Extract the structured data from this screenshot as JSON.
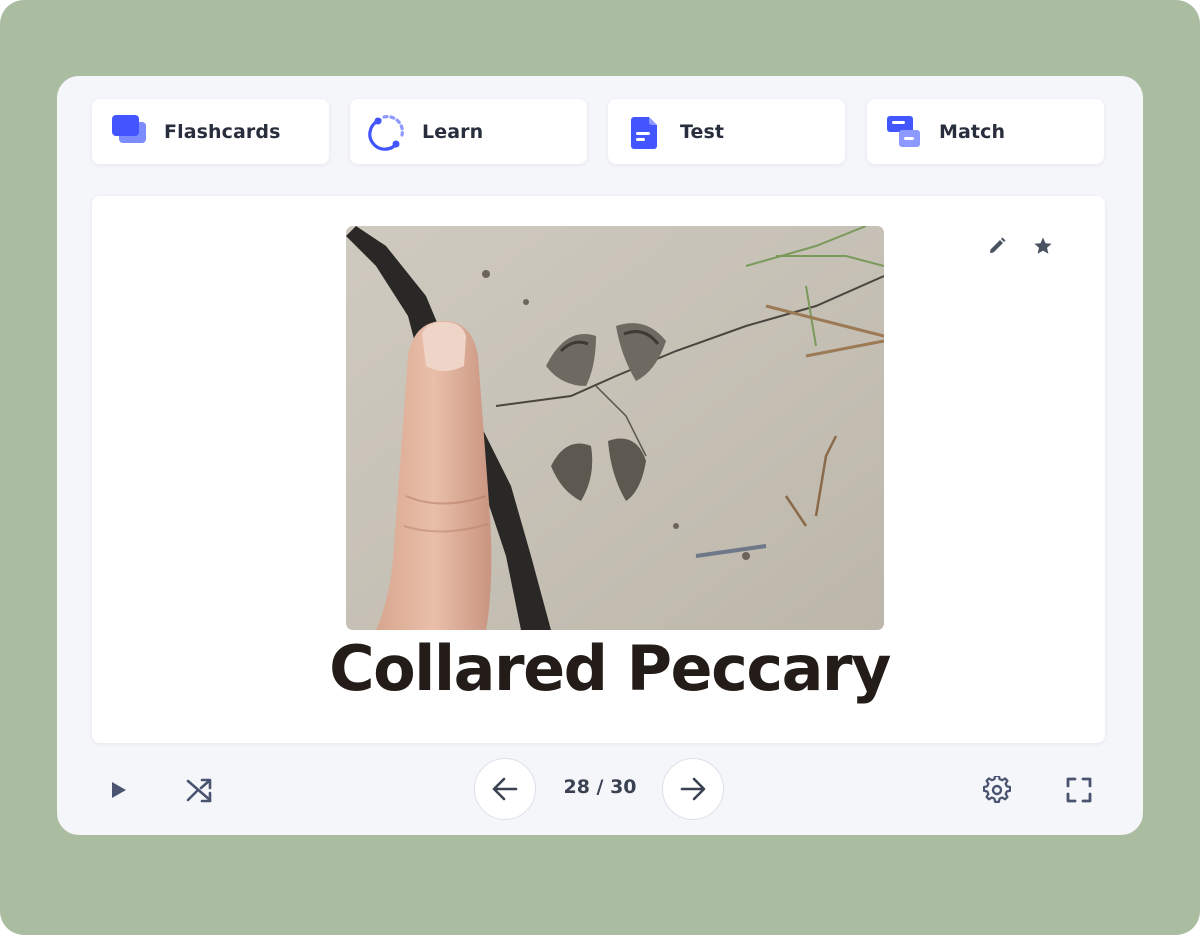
{
  "modes": {
    "flashcards": "Flashcards",
    "learn": "Learn",
    "test": "Test",
    "match": "Match"
  },
  "card": {
    "term": "Collared Peccary",
    "image_subject": "hoofprint in mud next to a finger for scale"
  },
  "navigation": {
    "current": "28",
    "total": "30",
    "counter_text": "28 / 30"
  },
  "icons": {
    "edit": "pencil-icon",
    "star": "star-icon",
    "play": "play-icon",
    "shuffle": "shuffle-icon",
    "prev": "arrow-left-icon",
    "next": "arrow-right-icon",
    "settings": "gear-icon",
    "fullscreen": "fullscreen-icon"
  },
  "colors": {
    "background": "#abbda1",
    "panel": "#f5f6fa",
    "accent": "#4255ff",
    "text": "#282e3e"
  }
}
